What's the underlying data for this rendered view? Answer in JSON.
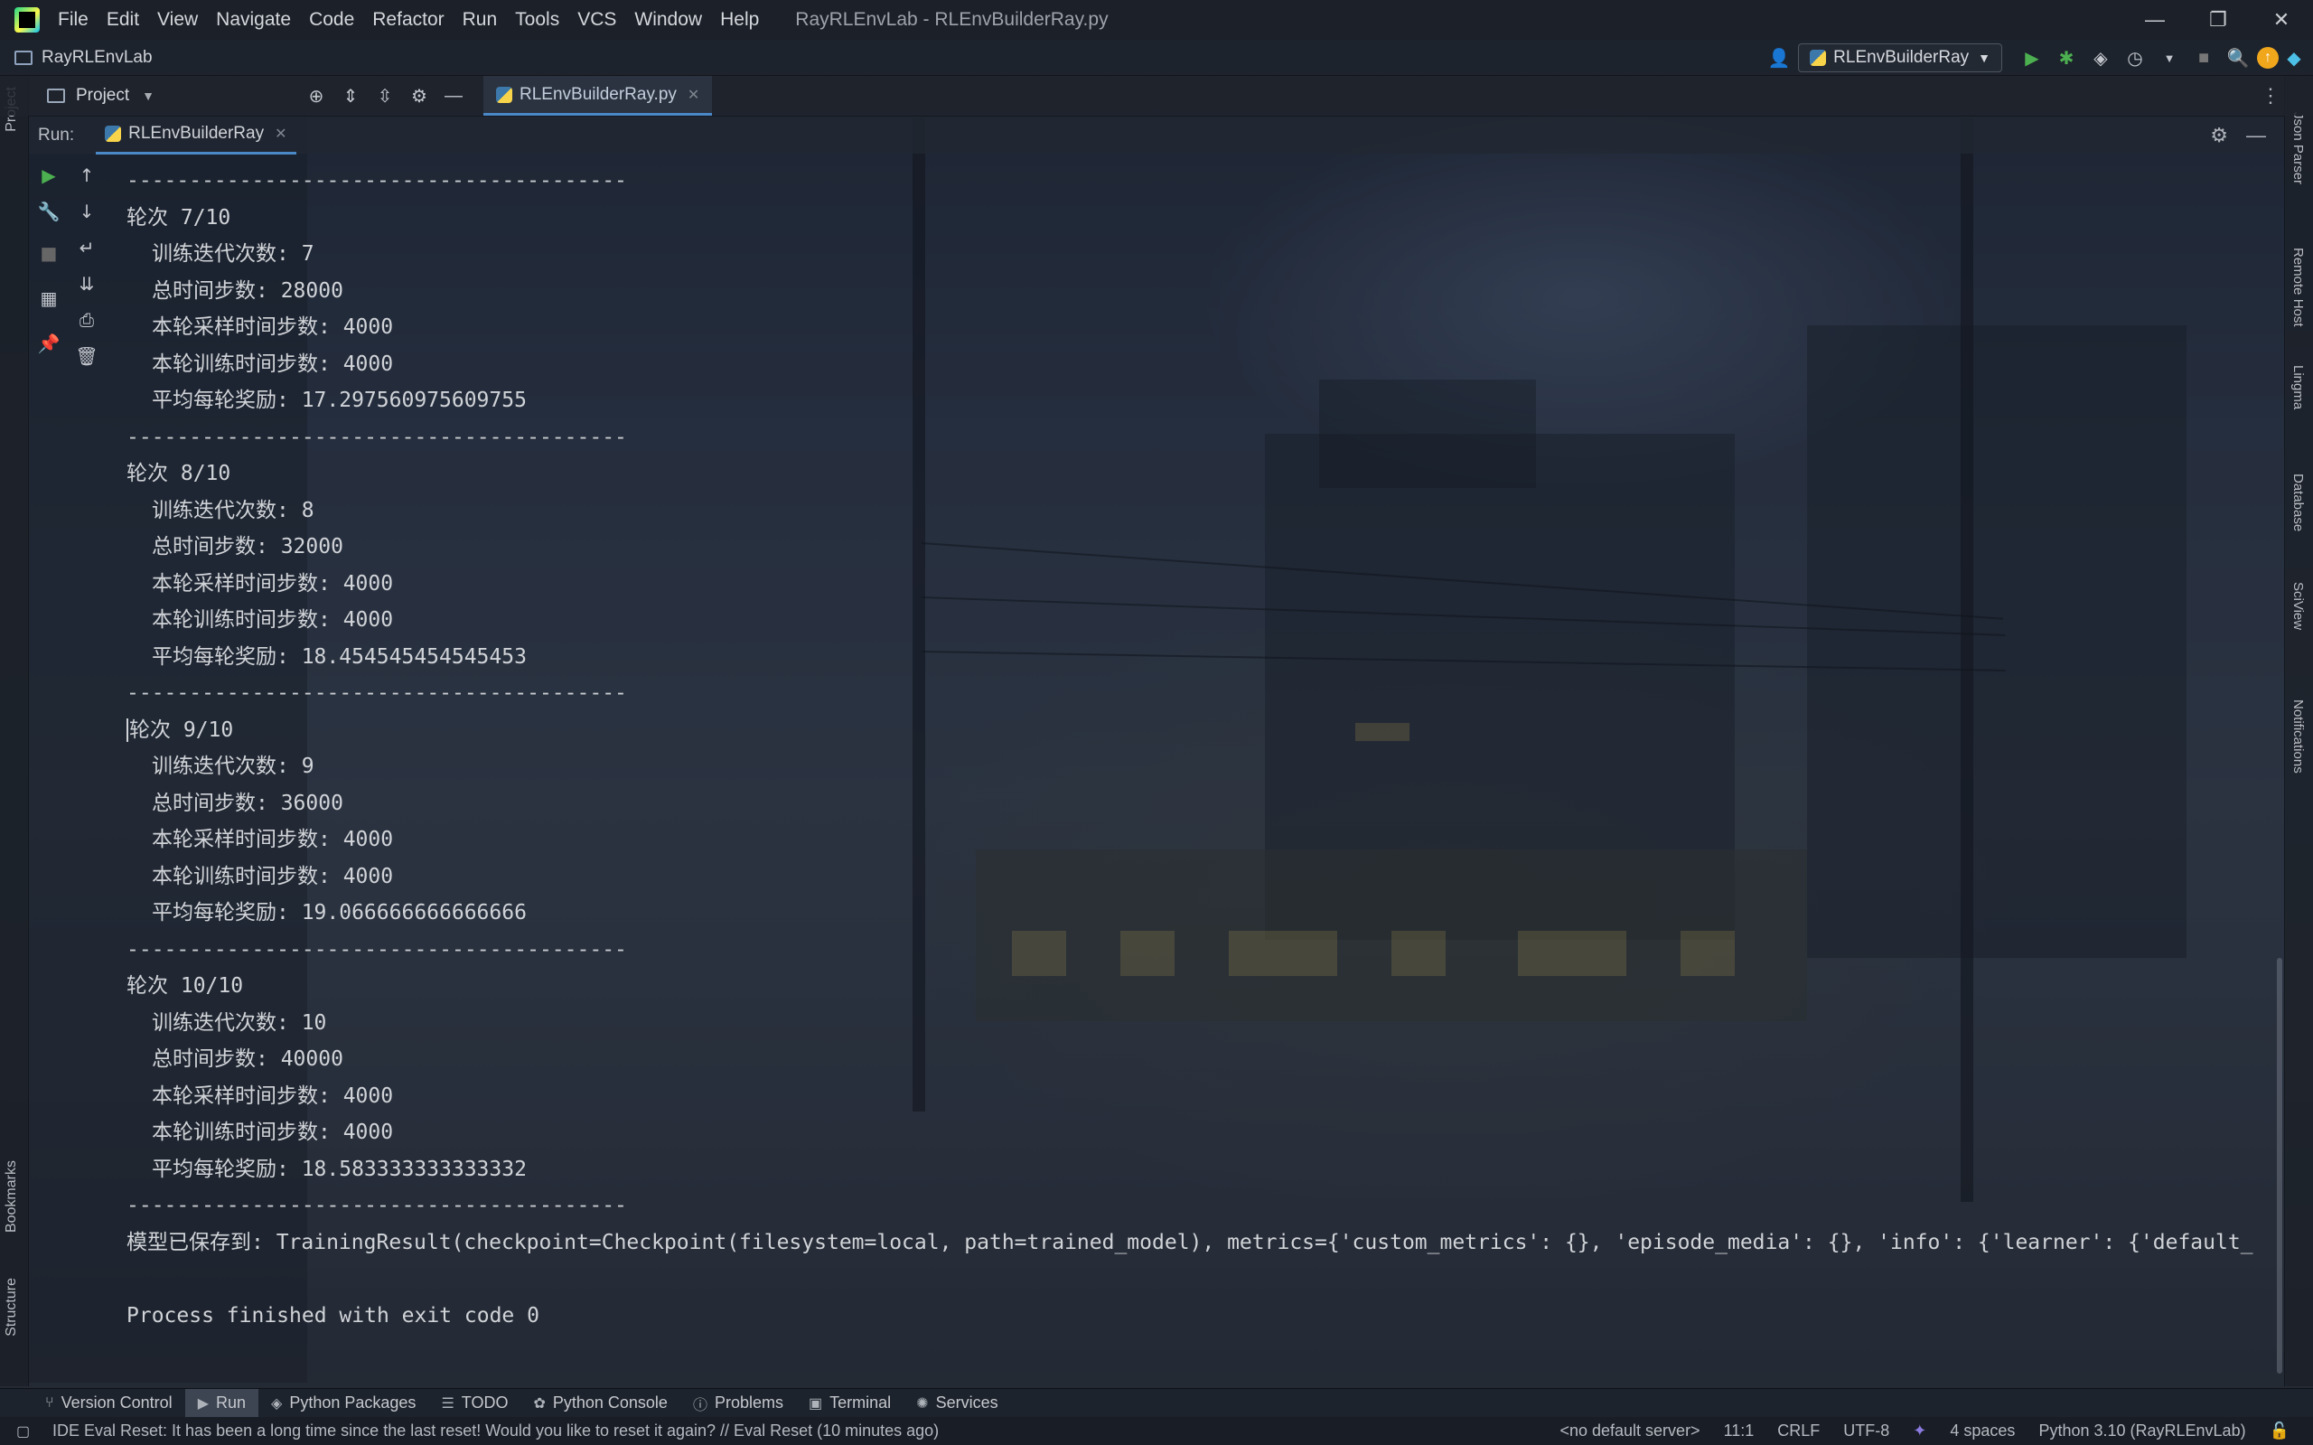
{
  "menu": {
    "items": [
      "File",
      "Edit",
      "View",
      "Navigate",
      "Code",
      "Refactor",
      "Run",
      "Tools",
      "VCS",
      "Window",
      "Help"
    ],
    "title": "RayRLEnvLab - RLEnvBuilderRay.py"
  },
  "window_controls": {
    "minimize": "—",
    "restore": "❐",
    "close": "✕"
  },
  "nav": {
    "breadcrumb": "RayRLEnvLab",
    "run_config": "RLEnvBuilderRay"
  },
  "toolbar": {
    "project_label": "Project",
    "editor_tab": "RLEnvBuilderRay.py"
  },
  "run": {
    "label": "Run:",
    "tab": "RLEnvBuilderRay"
  },
  "left_stripe": {
    "project": "Project",
    "bookmarks": "Bookmarks",
    "structure": "Structure"
  },
  "right_stripe": [
    "Json Parser",
    "Remote Host",
    "Lingma",
    "Database",
    "SciView",
    "Notifications"
  ],
  "console": {
    "separator": "----------------------------------------",
    "epochs": [
      {
        "header": "轮次 7/10",
        "iterations": "训练迭代次数: 7",
        "total_steps": "总时间步数: 28000",
        "sample_steps": "本轮采样时间步数: 4000",
        "train_steps": "本轮训练时间步数: 4000",
        "avg_reward": "平均每轮奖励: 17.297560975609755"
      },
      {
        "header": "轮次 8/10",
        "iterations": "训练迭代次数: 8",
        "total_steps": "总时间步数: 32000",
        "sample_steps": "本轮采样时间步数: 4000",
        "train_steps": "本轮训练时间步数: 4000",
        "avg_reward": "平均每轮奖励: 18.454545454545453"
      },
      {
        "header": "轮次 9/10",
        "iterations": "训练迭代次数: 9",
        "total_steps": "总时间步数: 36000",
        "sample_steps": "本轮采样时间步数: 4000",
        "train_steps": "本轮训练时间步数: 4000",
        "avg_reward": "平均每轮奖励: 19.066666666666666"
      },
      {
        "header": "轮次 10/10",
        "iterations": "训练迭代次数: 10",
        "total_steps": "总时间步数: 40000",
        "sample_steps": "本轮采样时间步数: 4000",
        "train_steps": "本轮训练时间步数: 4000",
        "avg_reward": "平均每轮奖励: 18.583333333333332"
      }
    ],
    "saved": "模型已保存到: TrainingResult(checkpoint=Checkpoint(filesystem=local, path=trained_model), metrics={'custom_metrics': {}, 'episode_media': {}, 'info': {'learner': {'default_",
    "finished": "Process finished with exit code 0"
  },
  "bottom_tabs": [
    {
      "label": "Version Control",
      "icon": "branch-icon"
    },
    {
      "label": "Run",
      "icon": "play-icon"
    },
    {
      "label": "Python Packages",
      "icon": "layers-icon"
    },
    {
      "label": "TODO",
      "icon": "list-icon"
    },
    {
      "label": "Python Console",
      "icon": "python-icon"
    },
    {
      "label": "Problems",
      "icon": "info-icon"
    },
    {
      "label": "Terminal",
      "icon": "terminal-icon"
    },
    {
      "label": "Services",
      "icon": "services-icon"
    }
  ],
  "status": {
    "message": "IDE Eval Reset: It has been a long time since the last reset! Would you like to reset it again? // Eval Reset (10 minutes ago)",
    "server": "<no default server>",
    "position": "11:1",
    "line_sep": "CRLF",
    "encoding": "UTF-8",
    "indent": "4 spaces",
    "interpreter": "Python 3.10 (RayRLEnvLab)"
  },
  "colors": {
    "accent": "#4a88c7",
    "run_green": "#4caf50"
  }
}
